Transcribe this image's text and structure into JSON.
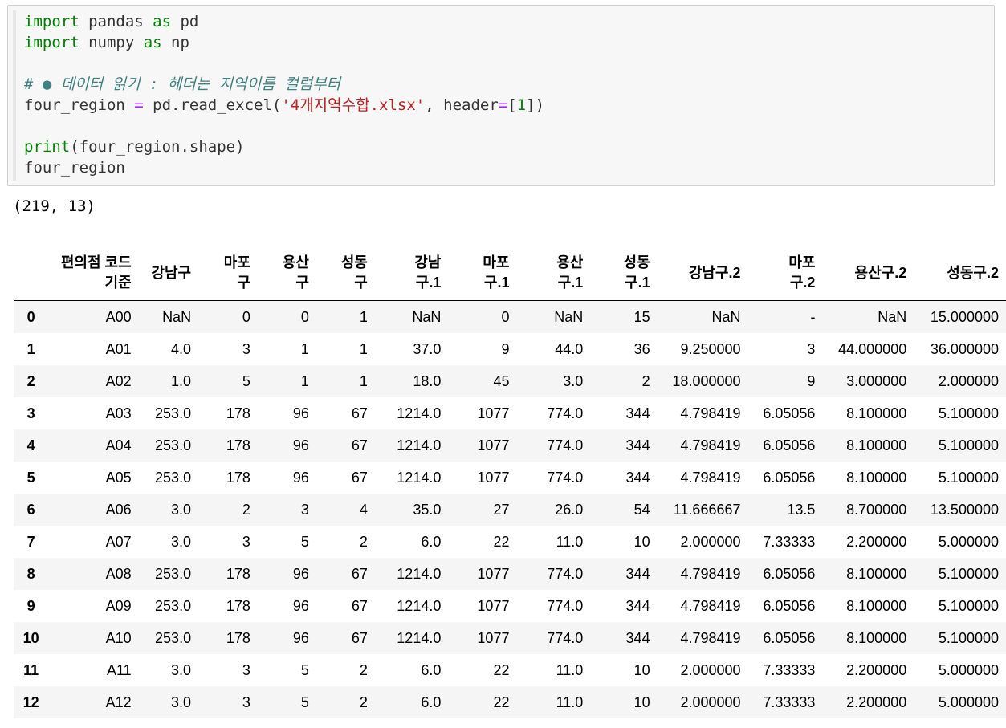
{
  "code_cell": {
    "lines": [
      "import pandas as pd",
      "import numpy as np",
      "",
      "# ● 데이터 읽기 : 헤더는 지역이름 컬럼부터",
      "four_region = pd.read_excel('4개지역수합.xlsx', header=[1])",
      "",
      "print(four_region.shape)",
      "four_region"
    ]
  },
  "output": {
    "shape_text": "(219, 13)"
  },
  "dataframe": {
    "columns": [
      [
        "편의점 코드",
        "기준"
      ],
      [
        "강남구"
      ],
      [
        "마포",
        "구"
      ],
      [
        "용산",
        "구"
      ],
      [
        "성동",
        "구"
      ],
      [
        "강남",
        "구.1"
      ],
      [
        "마포",
        "구.1"
      ],
      [
        "용산",
        "구.1"
      ],
      [
        "성동",
        "구.1"
      ],
      [
        "강남구.2"
      ],
      [
        "마포",
        "구.2"
      ],
      [
        "용산구.2"
      ],
      [
        "성동구.2"
      ]
    ],
    "rows": [
      {
        "index": "0",
        "cells": [
          "A00",
          "NaN",
          "0",
          "0",
          "1",
          "NaN",
          "0",
          "NaN",
          "15",
          "NaN",
          "-",
          "NaN",
          "15.000000"
        ]
      },
      {
        "index": "1",
        "cells": [
          "A01",
          "4.0",
          "3",
          "1",
          "1",
          "37.0",
          "9",
          "44.0",
          "36",
          "9.250000",
          "3",
          "44.000000",
          "36.000000"
        ]
      },
      {
        "index": "2",
        "cells": [
          "A02",
          "1.0",
          "5",
          "1",
          "1",
          "18.0",
          "45",
          "3.0",
          "2",
          "18.000000",
          "9",
          "3.000000",
          "2.000000"
        ]
      },
      {
        "index": "3",
        "cells": [
          "A03",
          "253.0",
          "178",
          "96",
          "67",
          "1214.0",
          "1077",
          "774.0",
          "344",
          "4.798419",
          "6.05056",
          "8.100000",
          "5.100000"
        ]
      },
      {
        "index": "4",
        "cells": [
          "A04",
          "253.0",
          "178",
          "96",
          "67",
          "1214.0",
          "1077",
          "774.0",
          "344",
          "4.798419",
          "6.05056",
          "8.100000",
          "5.100000"
        ]
      },
      {
        "index": "5",
        "cells": [
          "A05",
          "253.0",
          "178",
          "96",
          "67",
          "1214.0",
          "1077",
          "774.0",
          "344",
          "4.798419",
          "6.05056",
          "8.100000",
          "5.100000"
        ]
      },
      {
        "index": "6",
        "cells": [
          "A06",
          "3.0",
          "2",
          "3",
          "4",
          "35.0",
          "27",
          "26.0",
          "54",
          "11.666667",
          "13.5",
          "8.700000",
          "13.500000"
        ]
      },
      {
        "index": "7",
        "cells": [
          "A07",
          "3.0",
          "3",
          "5",
          "2",
          "6.0",
          "22",
          "11.0",
          "10",
          "2.000000",
          "7.33333",
          "2.200000",
          "5.000000"
        ]
      },
      {
        "index": "8",
        "cells": [
          "A08",
          "253.0",
          "178",
          "96",
          "67",
          "1214.0",
          "1077",
          "774.0",
          "344",
          "4.798419",
          "6.05056",
          "8.100000",
          "5.100000"
        ]
      },
      {
        "index": "9",
        "cells": [
          "A09",
          "253.0",
          "178",
          "96",
          "67",
          "1214.0",
          "1077",
          "774.0",
          "344",
          "4.798419",
          "6.05056",
          "8.100000",
          "5.100000"
        ]
      },
      {
        "index": "10",
        "cells": [
          "A10",
          "253.0",
          "178",
          "96",
          "67",
          "1214.0",
          "1077",
          "774.0",
          "344",
          "4.798419",
          "6.05056",
          "8.100000",
          "5.100000"
        ]
      },
      {
        "index": "11",
        "cells": [
          "A11",
          "3.0",
          "3",
          "5",
          "2",
          "6.0",
          "22",
          "11.0",
          "10",
          "2.000000",
          "7.33333",
          "2.200000",
          "5.000000"
        ]
      },
      {
        "index": "12",
        "cells": [
          "A12",
          "3.0",
          "3",
          "5",
          "2",
          "6.0",
          "22",
          "11.0",
          "10",
          "2.000000",
          "7.33333",
          "2.200000",
          "5.000000"
        ]
      }
    ]
  }
}
